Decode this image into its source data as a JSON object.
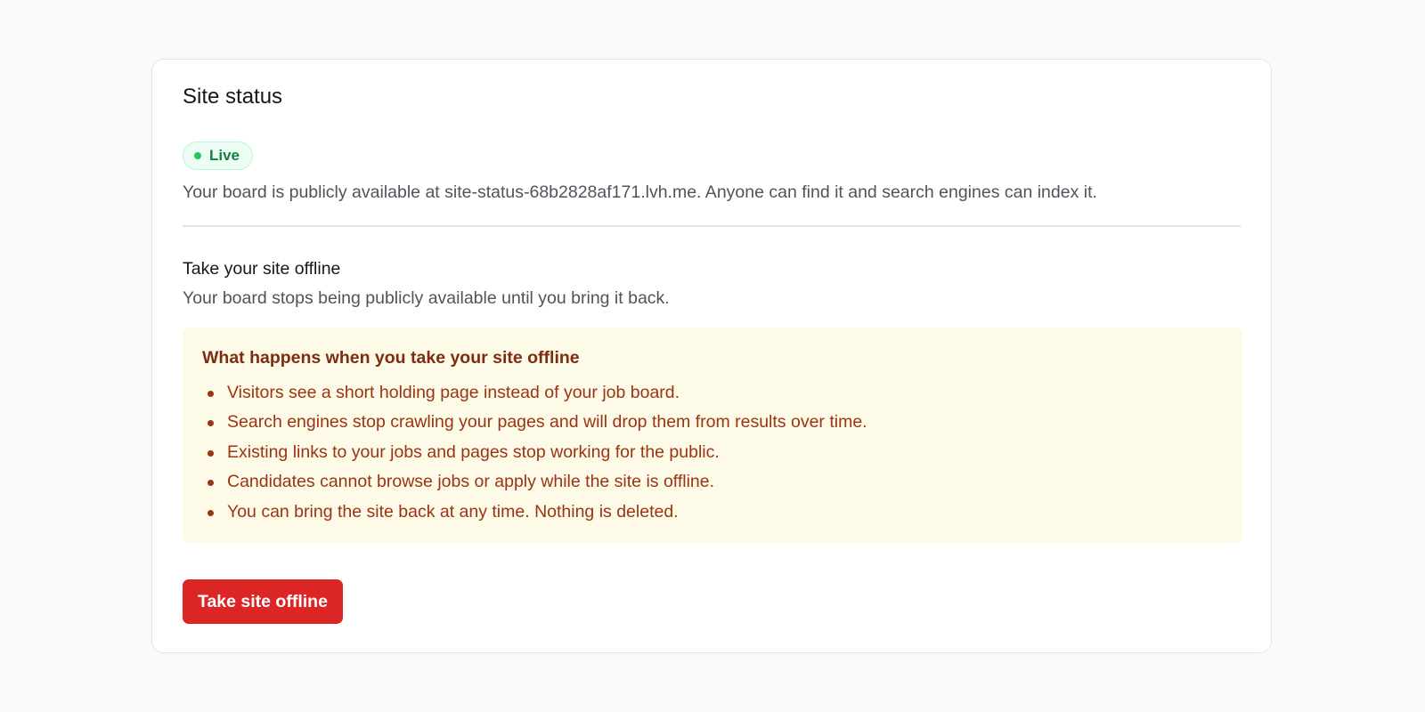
{
  "site_status": {
    "title": "Site status",
    "badge": {
      "label": "Live",
      "dot_color": "#22c55e"
    },
    "description": "Your board is publicly available at site-status-68b2828af171.lvh.me. Anyone can find it and search engines can index it."
  },
  "offline_section": {
    "title": "Take your site offline",
    "description": "Your board stops being publicly available until you bring it back.",
    "warning": {
      "title": "What happens when you take your site offline",
      "items": [
        "Visitors see a short holding page instead of your job board.",
        "Search engines stop crawling your pages and will drop them from results over time.",
        "Existing links to your jobs and pages stop working for the public.",
        "Candidates cannot browse jobs or apply while the site is offline.",
        "You can bring the site back at any time. Nothing is deleted."
      ]
    },
    "button_label": "Take site offline"
  },
  "colors": {
    "danger": "#dc2626",
    "success": "#22c55e",
    "warning_background": "#fefae8",
    "warning_text": "#9a3412"
  }
}
